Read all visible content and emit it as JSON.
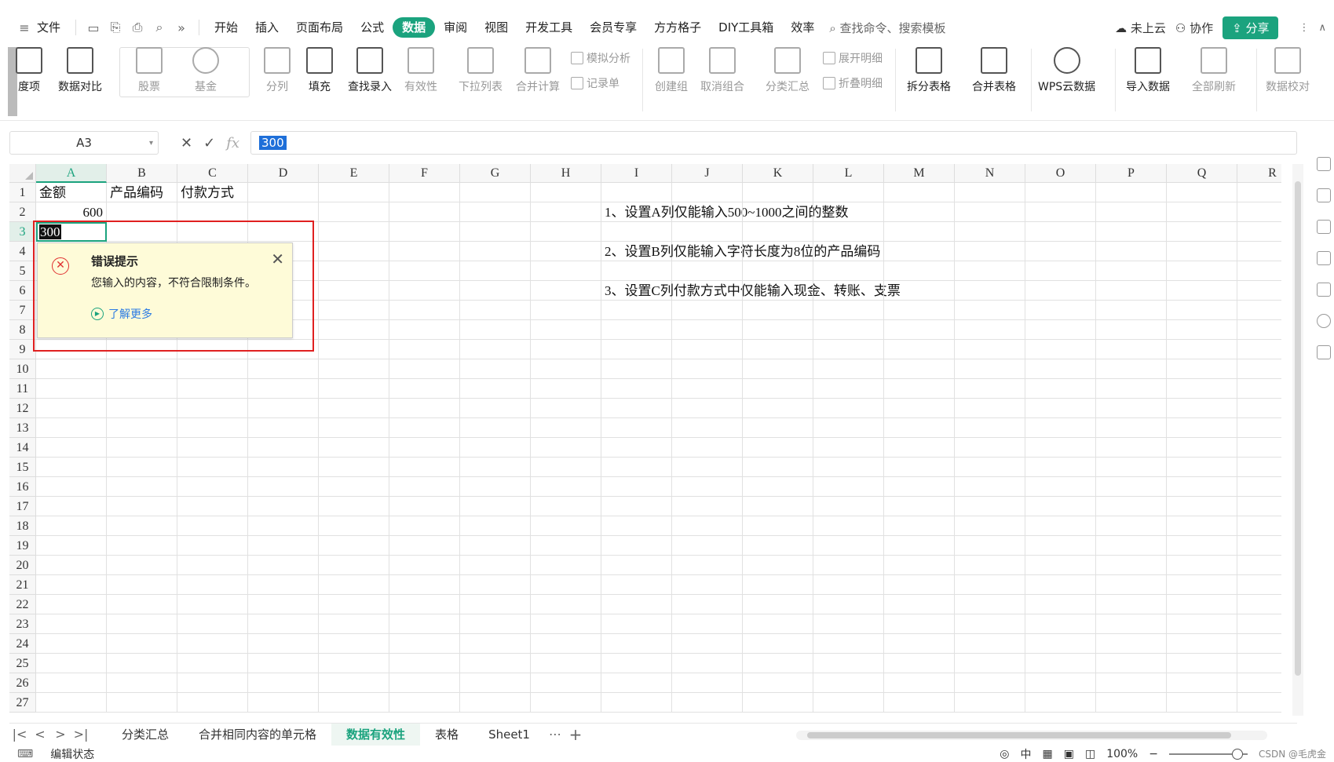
{
  "menubar": {
    "file_label": "文件",
    "tabs": [
      "开始",
      "插入",
      "页面布局",
      "公式",
      "数据",
      "审阅",
      "视图",
      "开发工具",
      "会员专享",
      "方方格子",
      "DIY工具箱",
      "效率"
    ],
    "active_tab": "数据",
    "search_placeholder": "查找命令、搜索模板",
    "cloud_label": "未上云",
    "collab_label": "协作",
    "share_label": "分享"
  },
  "ribbon": {
    "buttons": [
      {
        "label": "度项",
        "dim": false
      },
      {
        "label": "数据对比",
        "dim": false
      },
      {
        "label": "股票",
        "dim": true
      },
      {
        "label": "基金",
        "dim": true
      },
      {
        "label": "分列",
        "dim": true
      },
      {
        "label": "填充",
        "dim": false
      },
      {
        "label": "查找录入",
        "dim": false
      },
      {
        "label": "有效性",
        "dim": true
      },
      {
        "label": "下拉列表",
        "dim": true
      },
      {
        "label": "合并计算",
        "dim": true
      },
      {
        "label": "创建组",
        "dim": true
      },
      {
        "label": "取消组合",
        "dim": true
      },
      {
        "label": "分类汇总",
        "dim": true
      },
      {
        "label": "拆分表格",
        "dim": false
      },
      {
        "label": "合并表格",
        "dim": false
      },
      {
        "label": "WPS云数据",
        "dim": false
      },
      {
        "label": "导入数据",
        "dim": false
      },
      {
        "label": "全部刷新",
        "dim": true
      },
      {
        "label": "数据校对",
        "dim": true
      }
    ],
    "small_buttons": [
      "模拟分析",
      "记录单",
      "展开明细",
      "折叠明细"
    ]
  },
  "formula": {
    "cell_ref": "A3",
    "fx_label": "fx",
    "value": "300"
  },
  "grid": {
    "columns": [
      "A",
      "B",
      "C",
      "D",
      "E",
      "F",
      "G",
      "H",
      "I",
      "J",
      "K",
      "L",
      "M",
      "N",
      "O",
      "P",
      "Q",
      "R"
    ],
    "selected_column": "A",
    "selected_row": 3,
    "rows": [
      "1",
      "2",
      "3",
      "4",
      "5",
      "6",
      "7",
      "8",
      "9",
      "10",
      "11",
      "12",
      "13",
      "14",
      "15",
      "16",
      "17",
      "18",
      "19",
      "20",
      "21",
      "22",
      "23",
      "24",
      "25",
      "26",
      "27"
    ],
    "cells": {
      "A1": "金额",
      "B1": "产品编码",
      "C1": "付款方式",
      "A2": "600",
      "A3": "300",
      "I2": "1、设置A列仅能输入500~1000之间的整数",
      "I4": "2、设置B列仅能输入字符长度为8位的产品编码",
      "I6": "3、设置C列付款方式中仅能输入现金、转账、支票"
    }
  },
  "error_popup": {
    "title": "错误提示",
    "message": "您输入的内容，不符合限制条件。",
    "learn_more": "了解更多"
  },
  "sheets": {
    "tabs": [
      "分类汇总",
      "合并相同内容的单元格",
      "数据有效性",
      "表格",
      "Sheet1"
    ],
    "active": "数据有效性"
  },
  "status": {
    "mode": "编辑状态",
    "zoom": "100%",
    "watermark": "CSDN @毛虎金"
  },
  "colors": {
    "accent": "#1ba37e",
    "error_border": "#e02020",
    "popup_bg": "#fefbd8"
  }
}
